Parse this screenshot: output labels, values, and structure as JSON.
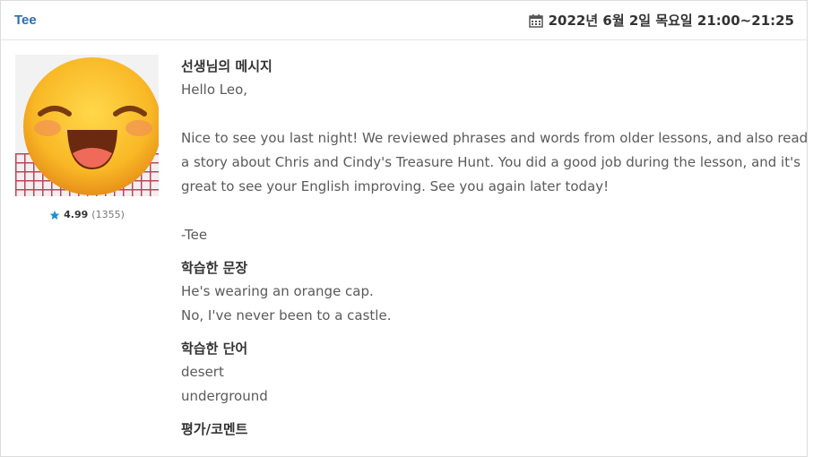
{
  "header": {
    "teacher_name": "Tee",
    "schedule": "2022년 6월 2일 목요일 21:00~21:25",
    "calendar_icon": "calendar-icon"
  },
  "profile": {
    "rating_score": "4.99",
    "rating_count": "(1355)",
    "star_icon": "star-icon",
    "star_color": "#1a8fd6"
  },
  "message": {
    "title": "선생님의 메시지",
    "greeting": "Hello Leo,",
    "body_lines": [
      "Nice to see you last night! We reviewed phrases and words from older lessons, and also read",
      "a story about Chris and Cindy's Treasure Hunt. You did a good job during the lesson, and it's",
      "great to see your English improving. See you again later today!"
    ],
    "signoff": "-Tee"
  },
  "sentences": {
    "title": "학습한 문장",
    "items": [
      "He's wearing an orange cap.",
      "No, I've never been to a castle."
    ]
  },
  "words": {
    "title": "학습한 단어",
    "items": [
      "desert",
      "underground"
    ]
  },
  "evaluation": {
    "title": "평가/코멘트"
  }
}
